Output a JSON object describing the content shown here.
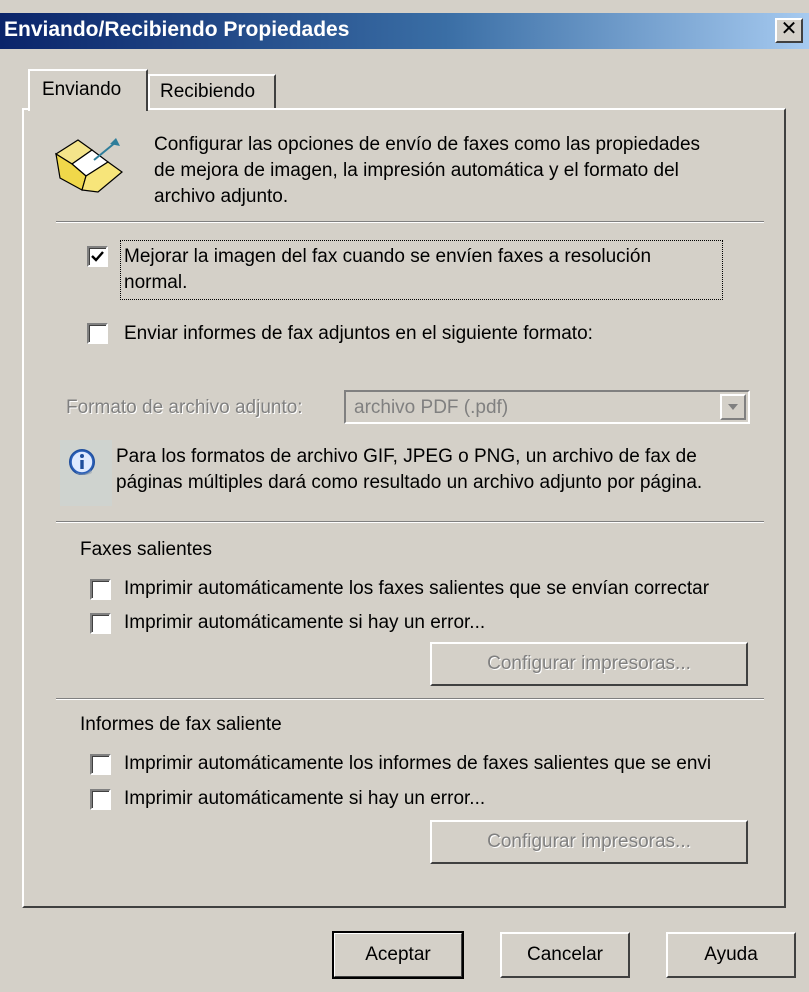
{
  "window": {
    "title": "Enviando/Recibiendo Propiedades",
    "close_glyph": "✕"
  },
  "tabs": [
    {
      "label": "Enviando",
      "active": true
    },
    {
      "label": "Recibiendo",
      "active": false
    }
  ],
  "intro": {
    "icon": "folder-send-icon",
    "lines": [
      "Configurar las opciones de envío de faxes como las propiedades",
      "de mejora de imagen, la impresión automática y el formato del",
      "archivo adjunto."
    ]
  },
  "enhance": {
    "checked": true,
    "line1": "Mejorar la imagen del fax cuando se envíen faxes a resolución",
    "line2": "normal."
  },
  "attach_reports": {
    "checked": false,
    "label": "Enviar informes de fax adjuntos en el siguiente formato:"
  },
  "attachment_format": {
    "label": "Formato de archivo adjunto:",
    "value": "archivo PDF (.pdf)"
  },
  "info": {
    "icon": "info-icon",
    "line1": "Para los formatos de archivo GIF, JPEG o PNG, un archivo de fax de",
    "line2": "páginas múltiples dará como resultado un archivo adjunto por página."
  },
  "outgoing_faxes": {
    "heading": "Faxes salientes",
    "option1": "Imprimir automáticamente los faxes salientes que se envían correctar",
    "option2": "Imprimir automáticamente si hay un error...",
    "button": "Configurar impresoras..."
  },
  "outgoing_reports": {
    "heading": "Informes de fax saliente",
    "option1": "Imprimir automáticamente los informes de faxes salientes que se envi",
    "option2": "Imprimir automáticamente si hay un error...",
    "button": "Configurar impresoras..."
  },
  "footer": {
    "ok": "Aceptar",
    "cancel": "Cancelar",
    "help": "Ayuda"
  }
}
